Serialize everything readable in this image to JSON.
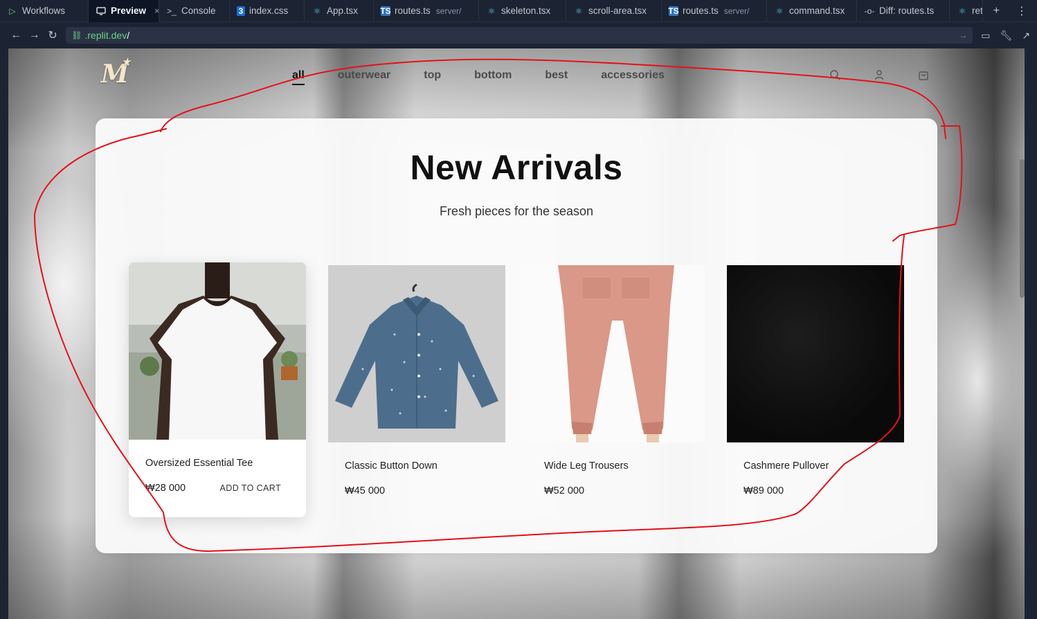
{
  "tabs": [
    {
      "label": "Workflows",
      "icon": "run-icon",
      "active": false
    },
    {
      "label": "Preview",
      "icon": "monitor-icon",
      "active": true
    },
    {
      "label": "Console",
      "icon": "terminal-icon",
      "active": false
    },
    {
      "label": "index.css",
      "icon": "css-file-icon",
      "active": false
    },
    {
      "label": "App.tsx",
      "icon": "react-file-icon",
      "active": false
    },
    {
      "label": "routes.ts",
      "sub": "server/",
      "icon": "ts-file-icon",
      "active": false
    },
    {
      "label": "skeleton.tsx",
      "icon": "react-file-icon",
      "active": false
    },
    {
      "label": "scroll-area.tsx",
      "icon": "react-file-icon",
      "active": false
    },
    {
      "label": "routes.ts",
      "sub": "server/",
      "icon": "ts-file-icon",
      "active": false
    },
    {
      "label": "command.tsx",
      "icon": "react-file-icon",
      "active": false
    },
    {
      "label": "Diff: routes.ts",
      "icon": "diff-icon",
      "active": false
    },
    {
      "label": "ret",
      "icon": "react-file-icon",
      "active": false
    }
  ],
  "address": {
    "host": ".replit.dev",
    "path": "/"
  },
  "site": {
    "logo": "M",
    "nav": [
      "all",
      "outerwear",
      "top",
      "bottom",
      "best",
      "accessories"
    ],
    "active_nav": "all"
  },
  "section": {
    "title": "New Arrivals",
    "subtitle": "Fresh pieces for the season"
  },
  "products": [
    {
      "name": "Oversized Essential Tee",
      "price": "₩28 000",
      "cta": "ADD TO CART",
      "hovered": true
    },
    {
      "name": "Classic Button Down",
      "price": "₩45 000"
    },
    {
      "name": "Wide Leg Trousers",
      "price": "₩52 000"
    },
    {
      "name": "Cashmere Pullover",
      "price": "₩89 000"
    }
  ],
  "colors": {
    "ide_bg": "#1c2333",
    "accent_green": "#6ad488",
    "annotation_red": "#e5101a"
  }
}
